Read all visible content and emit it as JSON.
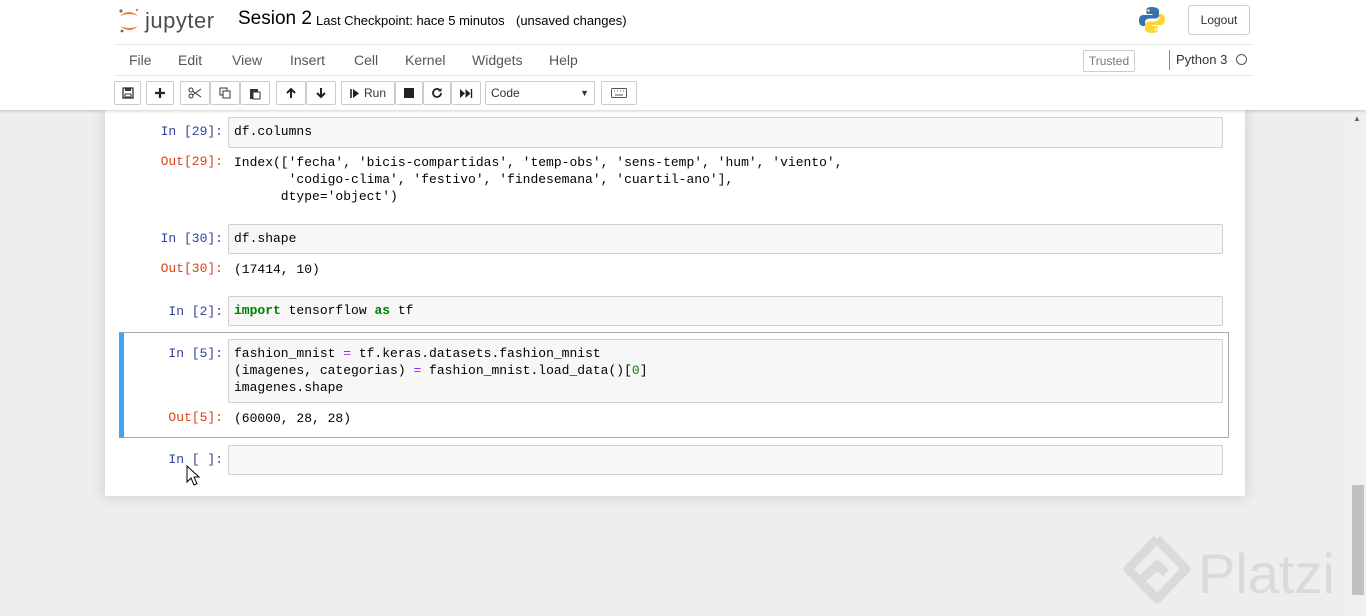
{
  "header": {
    "logo_text": "jupyter",
    "notebook_name": "Sesion 2",
    "checkpoint": "Last Checkpoint: hace 5 minutos",
    "unsaved": "(unsaved changes)",
    "logout_label": "Logout"
  },
  "menu": {
    "items": [
      "File",
      "Edit",
      "View",
      "Insert",
      "Cell",
      "Kernel",
      "Widgets",
      "Help"
    ],
    "trusted_label": "Trusted",
    "kernel_name": "Python 3"
  },
  "toolbar": {
    "run_label": "Run",
    "cell_type": "Code"
  },
  "cells": [
    {
      "prompt": "In [29]:",
      "code": "df.columns",
      "out_prompt": "Out[29]:",
      "output": "Index(['fecha', 'bicis-compartidas', 'temp-obs', 'sens-temp', 'hum', 'viento',\n       'codigo-clima', 'festivo', 'findesemana', 'cuartil-ano'],\n      dtype='object')"
    },
    {
      "prompt": "In [30]:",
      "code": "df.shape",
      "out_prompt": "Out[30]:",
      "output": "(17414, 10)"
    },
    {
      "prompt": "In [2]:",
      "code": "import tensorflow as tf"
    },
    {
      "prompt": "In [5]:",
      "code": "fashion_mnist = tf.keras.datasets.fashion_mnist\n(imagenes, categorias) = fashion_mnist.load_data()[0]\nimagenes.shape",
      "out_prompt": "Out[5]:",
      "output": "(60000, 28, 28)"
    },
    {
      "prompt": "In [ ]:",
      "code": ""
    }
  ],
  "watermark": "Platzi",
  "colors": {
    "prompt_in": "#303f9f",
    "prompt_out": "#d84315",
    "selected_border": "#42a5f5",
    "keyword": "#008000"
  }
}
